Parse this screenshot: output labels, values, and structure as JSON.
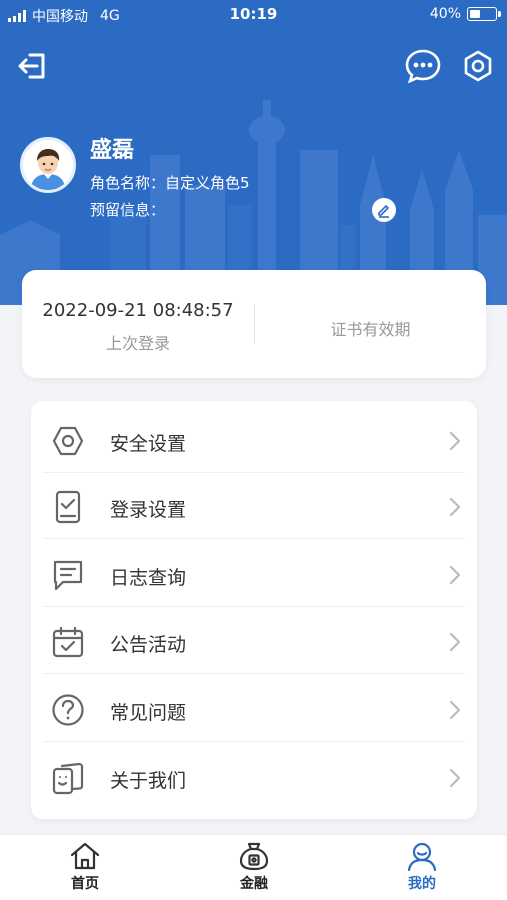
{
  "status_bar": {
    "carrier": "中国移动",
    "network": "4G",
    "time": "10:19",
    "battery": "40%",
    "battery_level": 0.4
  },
  "header": {
    "exit_icon": "exit-icon",
    "message_icon": "message-dots-icon",
    "settings_icon": "hexagon-settings-icon",
    "background_color": "#2c6bc4"
  },
  "profile": {
    "name": "盛磊",
    "role": "角色名称：自定义角色5",
    "reserve_info": "预留信息："
  },
  "login_card": {
    "last_login_time": "2022-09-21 08:48:57",
    "last_login_label": "上次登录",
    "cert_label": "证书有效期"
  },
  "menu": [
    {
      "label": "安全设置",
      "icon": "hexagon-nut-icon"
    },
    {
      "label": "登录设置",
      "icon": "device-check-icon"
    },
    {
      "label": "日志查询",
      "icon": "chat-log-icon"
    },
    {
      "label": "公告活动",
      "icon": "calendar-check-icon"
    },
    {
      "label": "常见问题",
      "icon": "question-circle-icon"
    },
    {
      "label": "关于我们",
      "icon": "cards-smile-icon"
    }
  ],
  "tabbar": [
    {
      "label": "首页",
      "icon": "home-icon",
      "active": false
    },
    {
      "label": "金融",
      "icon": "money-bag-icon",
      "active": false
    },
    {
      "label": "我的",
      "icon": "user-icon",
      "active": true
    }
  ],
  "colors": {
    "accent": "#2c6bc4",
    "icon_gray": "#666666",
    "page_bg": "#f3f4f8"
  }
}
